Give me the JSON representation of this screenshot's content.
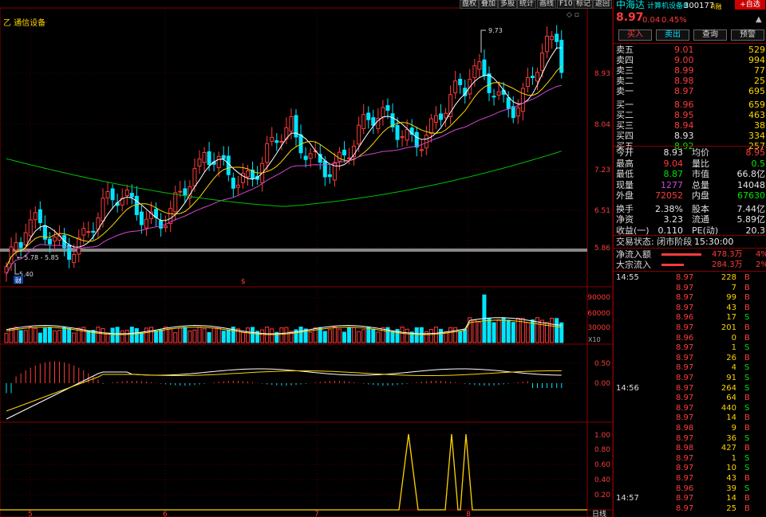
{
  "chart_title": "通信设备",
  "toolbar": [
    "盘权",
    "叠加",
    "多股",
    "统计",
    "画线",
    "F10",
    "标记",
    "返回"
  ],
  "stock": {
    "name": "中海达",
    "industry": "计算机设备Ⅲ",
    "code": "300177",
    "tag": "R融",
    "add_fav": "+自选",
    "price": "8.97",
    "change": "0.04",
    "change_pct": "0.45%"
  },
  "trade_buttons": [
    "买入",
    "卖出",
    "查询",
    "预警"
  ],
  "price_axis": [
    "8.93",
    "8.04",
    "7.23",
    "6.51",
    "5.86"
  ],
  "annotations": {
    "high": "9.73",
    "low": "5.40",
    "range": "5.78 - 5.85",
    "cai": "财",
    "dollar": "$"
  },
  "vol_axis": [
    "90000",
    "60000",
    "30000"
  ],
  "vol_mult": "X10",
  "macd_axis": [
    "0.50",
    "0.00"
  ],
  "ind_axis": [
    "1.00",
    "0.80",
    "0.60",
    "0.40",
    "0.20"
  ],
  "x_axis": [
    "5",
    "6",
    "7",
    "8"
  ],
  "period": "日线",
  "order_book": {
    "sell": [
      {
        "label": "卖五",
        "price": "9.01",
        "vol": "529"
      },
      {
        "label": "卖四",
        "price": "9.00",
        "vol": "994"
      },
      {
        "label": "卖三",
        "price": "8.99",
        "vol": "77"
      },
      {
        "label": "卖二",
        "price": "8.98",
        "vol": "25"
      },
      {
        "label": "卖一",
        "price": "8.97",
        "vol": "695"
      }
    ],
    "buy": [
      {
        "label": "买一",
        "price": "8.96",
        "vol": "659"
      },
      {
        "label": "买二",
        "price": "8.95",
        "vol": "463"
      },
      {
        "label": "买三",
        "price": "8.94",
        "vol": "38"
      },
      {
        "label": "买四",
        "price": "8.93",
        "vol": "334"
      },
      {
        "label": "买五",
        "price": "8.92",
        "vol": "257"
      }
    ]
  },
  "stats": [
    {
      "l1": "今开",
      "v1": "8.93",
      "c1": "white",
      "l2": "均价",
      "v2": "8.95",
      "c2": "red"
    },
    {
      "l1": "最高",
      "v1": "9.04",
      "c1": "red",
      "l2": "量比",
      "v2": "0.5",
      "c2": "green"
    },
    {
      "l1": "最低",
      "v1": "8.87",
      "c1": "green",
      "l2": "市值",
      "v2": "66.8亿",
      "c2": "white"
    },
    {
      "l1": "现量",
      "v1": "1277",
      "c1": "purple",
      "l2": "总量",
      "v2": "14048",
      "c2": "white"
    },
    {
      "l1": "外盘",
      "v1": "72052",
      "c1": "red",
      "l2": "内盘",
      "v2": "67630",
      "c2": "green"
    },
    {
      "l1": "换手",
      "v1": "2.38%",
      "c1": "white",
      "l2": "股本",
      "v2": "7.44亿",
      "c2": "white"
    },
    {
      "l1": "净资",
      "v1": "3.23",
      "c1": "white",
      "l2": "流通",
      "v2": "5.89亿",
      "c2": "white"
    },
    {
      "l1": "收益(一)",
      "v1": "0.110",
      "c1": "white",
      "l2": "PE(动)",
      "v2": "20.3",
      "c2": "white"
    }
  ],
  "trade_status": "交易状态: 闭市阶段",
  "trade_time": "15:30:00",
  "net_inflow": {
    "label": "净流入额",
    "value": "478.3万",
    "pct": "4%"
  },
  "block_inflow": {
    "label": "大宗流入",
    "value": "284.3万",
    "pct": "2%"
  },
  "ticks": [
    {
      "t": "14:55",
      "p": "8.97",
      "v": "228",
      "s": "B"
    },
    {
      "t": "",
      "p": "8.97",
      "v": "7",
      "s": "B"
    },
    {
      "t": "",
      "p": "8.97",
      "v": "99",
      "s": "B"
    },
    {
      "t": "",
      "p": "8.97",
      "v": "43",
      "s": "B"
    },
    {
      "t": "",
      "p": "8.96",
      "v": "17",
      "s": "S"
    },
    {
      "t": "",
      "p": "8.97",
      "v": "201",
      "s": "B"
    },
    {
      "t": "",
      "p": "8.96",
      "v": "0",
      "s": "B"
    },
    {
      "t": "",
      "p": "8.97",
      "v": "1",
      "s": "S"
    },
    {
      "t": "",
      "p": "8.97",
      "v": "26",
      "s": "B"
    },
    {
      "t": "",
      "p": "8.97",
      "v": "4",
      "s": "S"
    },
    {
      "t": "",
      "p": "8.97",
      "v": "91",
      "s": "S"
    },
    {
      "t": "14:56",
      "p": "8.97",
      "v": "264",
      "s": "S"
    },
    {
      "t": "",
      "p": "8.97",
      "v": "64",
      "s": "B"
    },
    {
      "t": "",
      "p": "8.97",
      "v": "440",
      "s": "S"
    },
    {
      "t": "",
      "p": "8.97",
      "v": "14",
      "s": "B"
    },
    {
      "t": "",
      "p": "8.98",
      "v": "9",
      "s": "B"
    },
    {
      "t": "",
      "p": "8.97",
      "v": "36",
      "s": "S"
    },
    {
      "t": "",
      "p": "8.98",
      "v": "427",
      "s": "B"
    },
    {
      "t": "",
      "p": "8.97",
      "v": "1",
      "s": "S"
    },
    {
      "t": "",
      "p": "8.97",
      "v": "10",
      "s": "S"
    },
    {
      "t": "",
      "p": "8.97",
      "v": "43",
      "s": "B"
    },
    {
      "t": "",
      "p": "8.96",
      "v": "39",
      "s": "S"
    },
    {
      "t": "14:57",
      "p": "8.97",
      "v": "14",
      "s": "B"
    },
    {
      "t": "",
      "p": "8.97",
      "v": "25",
      "s": "B"
    }
  ],
  "colors": {
    "up": "#ff3b3b",
    "down": "#00e5ff",
    "grid": "#8b0000",
    "ma5": "#ffffff",
    "ma10": "#ffd400",
    "ma20": "#d048d0",
    "ma60": "#00c000"
  }
}
